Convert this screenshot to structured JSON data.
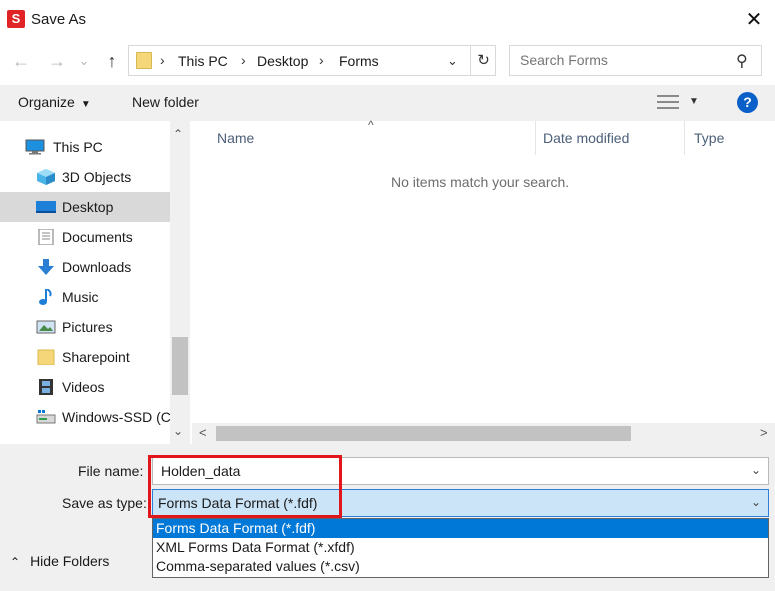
{
  "window": {
    "app_icon_letter": "S",
    "title": "Save As",
    "close_glyph": "✕"
  },
  "nav": {
    "back_icon": "←",
    "forward_icon": "→",
    "recent_icon": "⌄",
    "up_icon": "↑"
  },
  "address": {
    "sep": "›",
    "crumbs": [
      "This PC",
      "Desktop",
      "Forms"
    ],
    "dropdown_glyph": "⌄",
    "refresh_glyph": "↻"
  },
  "search": {
    "placeholder": "Search Forms",
    "icon": "⚲"
  },
  "toolbar": {
    "organize_label": "Organize",
    "caret": "▼",
    "new_folder_label": "New folder",
    "view_caret": "▼",
    "help_label": "?"
  },
  "sidebar": {
    "items": [
      {
        "label": "This PC",
        "icon": "computer-icon"
      },
      {
        "label": "3D Objects",
        "icon": "cube-icon"
      },
      {
        "label": "Desktop",
        "icon": "desktop-icon",
        "selected": true
      },
      {
        "label": "Documents",
        "icon": "document-icon"
      },
      {
        "label": "Downloads",
        "icon": "download-icon"
      },
      {
        "label": "Music",
        "icon": "music-icon"
      },
      {
        "label": "Pictures",
        "icon": "pictures-icon"
      },
      {
        "label": "Sharepoint",
        "icon": "folder-icon"
      },
      {
        "label": "Videos",
        "icon": "videos-icon"
      },
      {
        "label": "Windows-SSD (C",
        "icon": "drive-icon"
      }
    ],
    "scroll_up": "⌃",
    "scroll_down": "⌄"
  },
  "file_list": {
    "columns": {
      "name": "Name",
      "date": "Date modified",
      "type": "Type"
    },
    "sort_caret": "^",
    "empty_message": "No items match your search.",
    "scroll_left": "<",
    "scroll_right": ">"
  },
  "form": {
    "file_name_label": "File name:",
    "file_name_value": "Holden_data",
    "save_type_label": "Save as type:",
    "save_type_value": "Forms Data Format (*.fdf)",
    "chevron": "⌄",
    "type_options": [
      "Forms Data Format (*.fdf)",
      "XML Forms Data Format (*.xfdf)",
      "Comma-separated values (*.csv)"
    ],
    "hide_folders_caret": "⌃",
    "hide_folders_label": "Hide Folders"
  },
  "colors": {
    "accent": "#0078d7",
    "highlight_annotation": "#e0161c",
    "selected_type_bg": "#cce4f7"
  }
}
